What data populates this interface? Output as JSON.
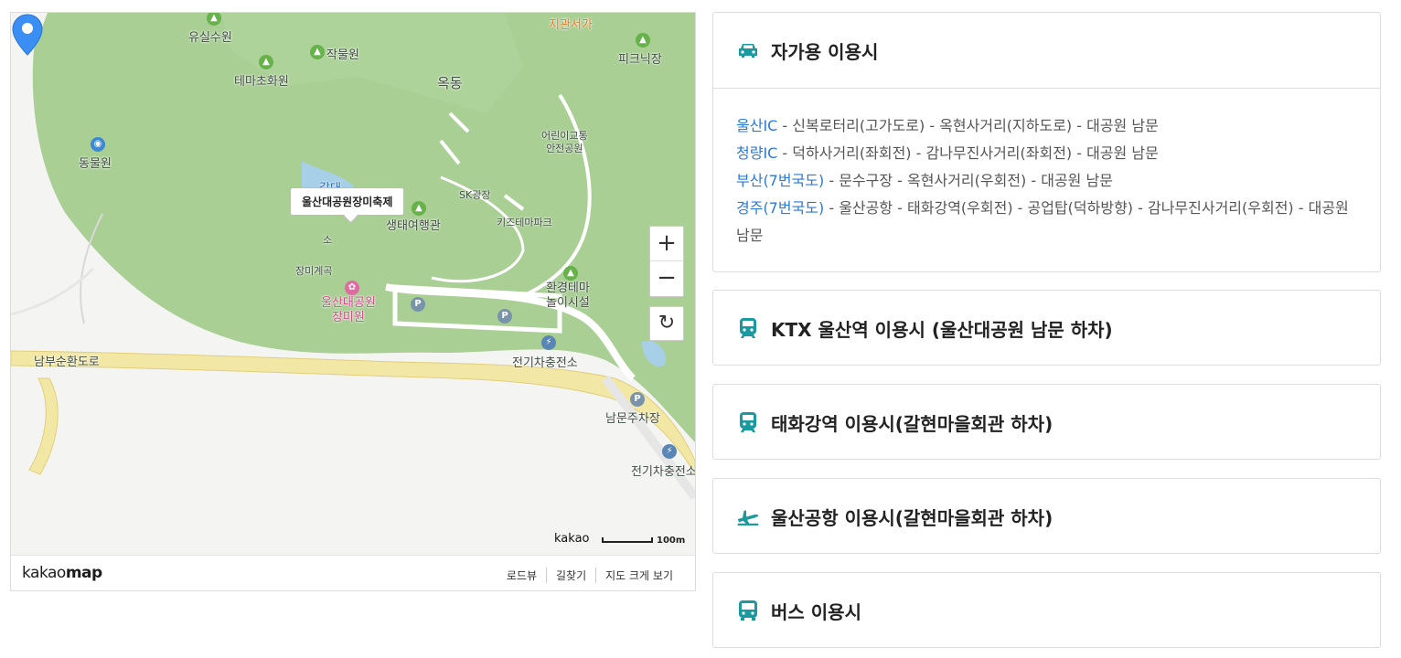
{
  "map": {
    "labels": {
      "yusilsuwon": "유실수원",
      "jakmulwon": "작물원",
      "themacho": "테마초화원",
      "okdong": "옥동",
      "picnic": "피크닉장",
      "jigwan": "지관서가",
      "dongmulwon": "동물원",
      "children": "어린이교통\n안전공원",
      "sk": "SK광장",
      "saengtae": "생태여행관",
      "kids": "키즈테마파크",
      "ganmul": "갈대",
      "so": "소",
      "jangmigyegok": "장미계곡",
      "ulsanpark": "울산대공원\n장미원",
      "hwangyeong": "환경테마\n놀이시설",
      "ev1": "전기차충전소",
      "nambu": "남부순환도로",
      "parking": "남문주차장",
      "ev2": "전기차충전소"
    },
    "callout": "울산대공원장미축제",
    "zoom_in": "+",
    "zoom_out": "−",
    "reset_icon": "↻",
    "scale_brand": "kakao",
    "scale_value": "100m",
    "footer": {
      "brand_light": "kakao",
      "brand_bold": "map",
      "links": [
        "로드뷰",
        "길찾기",
        "지도 크게 보기"
      ]
    }
  },
  "panels": [
    {
      "title": "자가용 이용시",
      "icon": "car-icon",
      "expanded": true,
      "routes": [
        {
          "link": "울산IC",
          "text": " - 신복로터리(고가도로) - 옥현사거리(지하도로) - 대공원 남문"
        },
        {
          "link": "청량IC",
          "text": " - 덕하사거리(좌회전) - 감나무진사거리(좌회전) - 대공원 남문"
        },
        {
          "link": "부산(7번국도)",
          "text": " - 문수구장 - 옥현사거리(우회전) - 대공원 남문"
        },
        {
          "link": "경주(7번국도)",
          "text": " - 울산공항 - 태화강역(우회전) - 공업탑(덕하방향) - 감나무진사거리(우회전) - 대공원 남문"
        }
      ]
    },
    {
      "title": "KTX 울산역 이용시 (울산대공원 남문 하차)",
      "icon": "train-icon"
    },
    {
      "title": "태화강역 이용시(갈현마을회관 하차)",
      "icon": "train-icon"
    },
    {
      "title": "울산공항 이용시(갈현마을회관 하차)",
      "icon": "airplane-icon"
    },
    {
      "title": "버스 이용시",
      "icon": "bus-icon"
    }
  ],
  "colors": {
    "accent": "#1a9aa0",
    "link": "#2b7bd6",
    "park": "#a9cf95",
    "road": "#f3e7a6"
  }
}
